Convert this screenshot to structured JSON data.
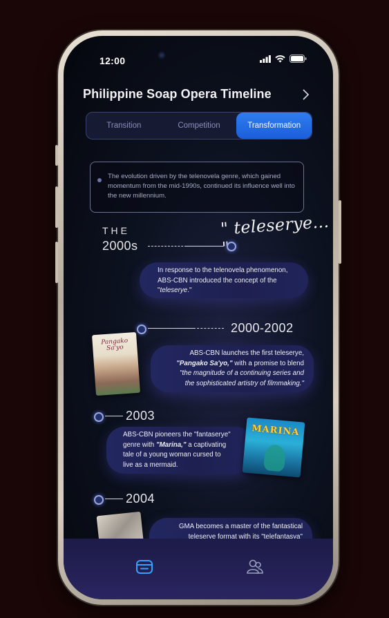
{
  "status": {
    "time": "12:00"
  },
  "header": {
    "title": "Philippine Soap Opera Timeline"
  },
  "tabs": [
    {
      "label": "Transition",
      "active": false
    },
    {
      "label": "Competition",
      "active": false
    },
    {
      "label": "Transformation",
      "active": true
    }
  ],
  "info": {
    "text": "The evolution driven by the telenovela genre, which gained momentum from the mid-1990s, continued its influence well into the new millennium."
  },
  "intro": {
    "the": "THE",
    "era": "2000s",
    "quote": "\" teleserye... \"",
    "text_before": "In response to the telenovela phenomenon, ABS-CBN introduced the concept of the \"",
    "text_em": "teleserye",
    "text_after": ".\""
  },
  "entries": [
    {
      "year": "2000-2002",
      "image": "Pangako Sa'yo poster",
      "line1": "ABS-CBN launches the first teleserye,",
      "line2_em": "\"Pangako Sa'yo,\"",
      "line2_rest": " with a promise to blend",
      "line3": "\"the magnitude of a continuing series and",
      "line4": "the sophisticated artistry of filmmaking.\""
    },
    {
      "year": "2003",
      "image": "Marina poster",
      "line1": "ABS-CBN pioneers the \"fantaserye\"",
      "line2_pre": "genre with ",
      "line2_em": "\"Marina,\"",
      "line2_rest": " a captivating",
      "line3": "tale of a young woman cursed to",
      "line4": "live as a mermaid."
    },
    {
      "year": "2004",
      "image": "Mulawin poster",
      "line1": "GMA becomes a master of the fantastical",
      "line2": "teleserye format with its \"telefantasya\""
    }
  ],
  "poster_titles": {
    "pangako": "Pangako Sa'yo",
    "marina": "MARINA"
  },
  "nav": [
    {
      "icon": "timeline-icon",
      "active": true
    },
    {
      "icon": "people-icon",
      "active": false
    }
  ],
  "colors": {
    "accent": "#2f7df0",
    "node": "#22306a",
    "bubble": "#232760"
  }
}
